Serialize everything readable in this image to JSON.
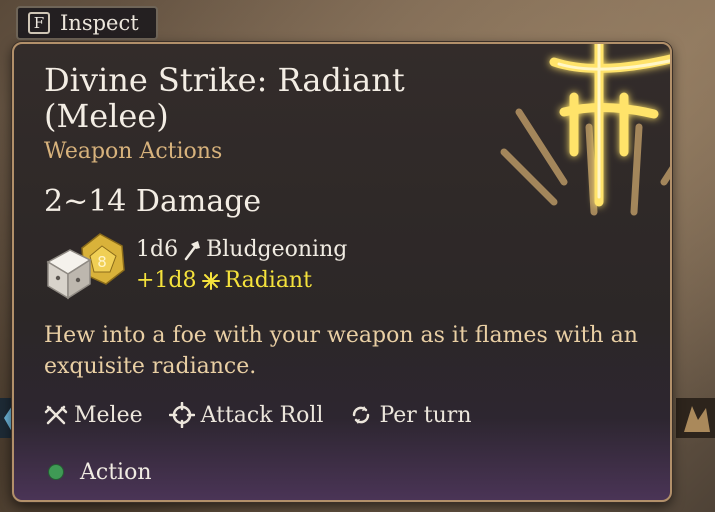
{
  "prompt": {
    "key": "F",
    "label": "Inspect"
  },
  "tooltip": {
    "title": "Divine Strike: Radiant (Melee)",
    "category": "Weapon Actions",
    "damage_total": "2~14 Damage",
    "damage": [
      {
        "dice": "1d6",
        "type": "Bludgeoning",
        "icon": "mace-icon"
      },
      {
        "dice": "+1d8",
        "type": "Radiant",
        "icon": "radiant-icon"
      }
    ],
    "die_face": "8",
    "description": "Hew into a foe with your weapon as it flames with an exquisite radiance.",
    "tags": [
      {
        "label": "Melee",
        "icon": "crossed-swords-icon"
      },
      {
        "label": "Attack Roll",
        "icon": "crosshair-icon"
      },
      {
        "label": "Per turn",
        "icon": "cycle-icon"
      }
    ],
    "cost": "Action"
  },
  "colors": {
    "accent_gold": "#d7b27c",
    "radiant_yellow": "#f5e23c",
    "action_green": "#3f9a55",
    "border": "#b2906a"
  }
}
